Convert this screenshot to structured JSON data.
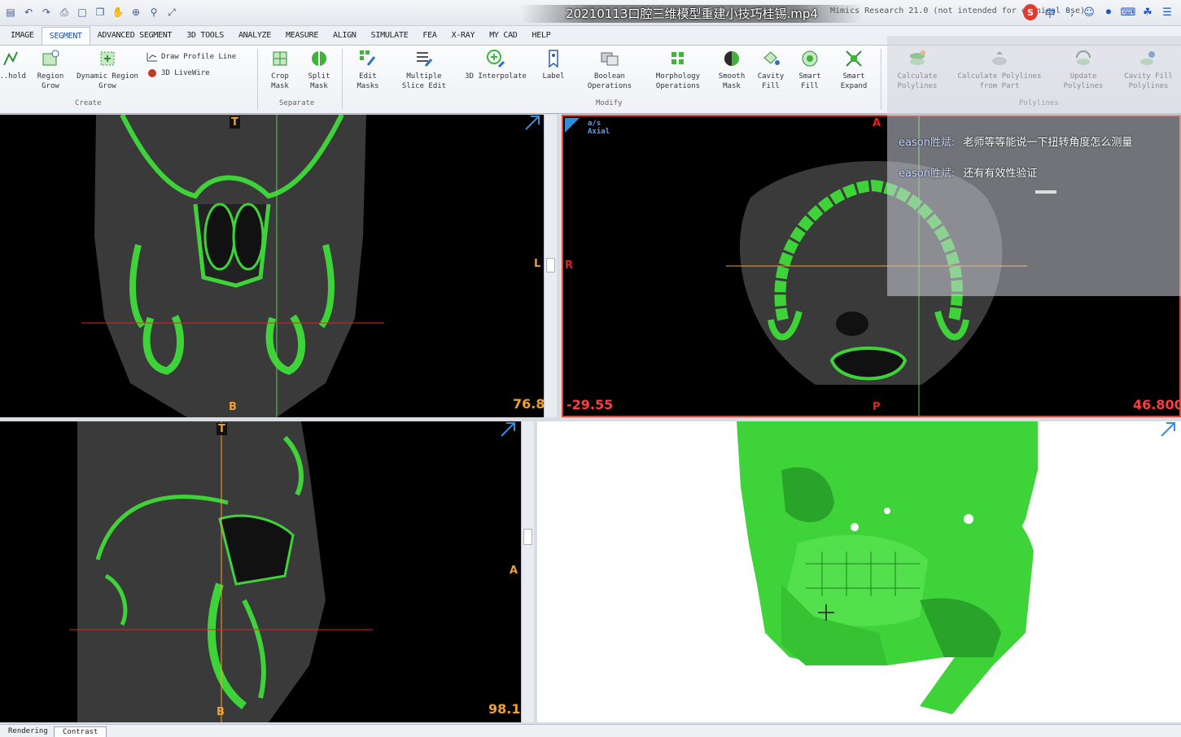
{
  "video_title": "20210113口腔三维模型重建小技巧桂锡.mp4",
  "app_title": "Mimics Research 21.0 (not intended for clinical use)",
  "quick_access": [
    "save-icon",
    "undo-icon",
    "redo-icon",
    "print-icon",
    "crop-icon",
    "copy-icon",
    "hand-icon",
    "zoom-icon",
    "search-icon",
    "fit-icon"
  ],
  "tray_icons": [
    "sogou-icon",
    "chinese-input-icon",
    "punctuation-icon",
    "emoji-icon",
    "mic-icon",
    "keyboard-icon",
    "skin-icon",
    "menu-icon"
  ],
  "tray_brand": "S",
  "tray_lang": "中",
  "tabs": [
    "IMAGE",
    "SEGMENT",
    "ADVANCED SEGMENT",
    "3D TOOLS",
    "ANALYZE",
    "MEASURE",
    "ALIGN",
    "SIMULATE",
    "FEA",
    "X-RAY",
    "MY CAD",
    "HELP"
  ],
  "active_tab": "SEGMENT",
  "ribbon": {
    "create": {
      "group_label": "Create",
      "threshold": "...hold",
      "region_grow": "Region\nGrow",
      "dynamic_region_grow": "Dynamic Region\nGrow",
      "draw_profile_line": "Draw Profile Line",
      "livewire": "3D LiveWire"
    },
    "separate": {
      "group_label": "Separate",
      "crop_mask": "Crop\nMask",
      "split_mask": "Split\nMask"
    },
    "modify": {
      "group_label": "Modify",
      "edit_masks": "Edit\nMasks",
      "multiple_slice_edit": "Multiple\nSlice Edit",
      "interpolate_3d": "3D Interpolate",
      "label": "Label",
      "boolean_operations": "Boolean\nOperations",
      "morphology_operations": "Morphology\nOperations",
      "smooth_mask": "Smooth\nMask",
      "cavity_fill": "Cavity\nFill",
      "smart_fill": "Smart\nFill",
      "smart_expand": "Smart\nExpand"
    },
    "polylines": {
      "group_label": "Polylines",
      "calculate_polylines": "Calculate\nPolylines",
      "calculate_polylines_from_part": "Calculate Polylines\nfrom Part",
      "update_polylines": "Update\nPolylines",
      "cavity_fill_polylines": "Cavity Fill\nPolylines"
    }
  },
  "views": {
    "coronal": {
      "top": "T",
      "bottom": "B",
      "right": "L",
      "value": "76.8"
    },
    "axial": {
      "top": "A",
      "bottom": "P",
      "left": "R",
      "value_left": "-29.55",
      "value_right": "46.800",
      "corner": "a/s\nAxial"
    },
    "sagittal": {
      "top": "T",
      "bottom": "B",
      "right": "A",
      "value": "98.1"
    }
  },
  "chat": [
    {
      "user": "eason胜斌:",
      "text": "老师等等能说一下扭转角度怎么测量"
    },
    {
      "user": "eason胜斌:",
      "text": "还有有效性验证"
    }
  ],
  "status_tabs": [
    "Rendering",
    "Contrast"
  ],
  "active_status_tab": "Contrast",
  "colors": {
    "mask_green": "#3fd33a",
    "crosshair_red": "#e02424",
    "crosshair_orange": "#f0a030",
    "crosshair_green": "#5ccf4a",
    "viewport_active_border": "#e8443a",
    "ribbon_blue": "#1d4f9a"
  }
}
